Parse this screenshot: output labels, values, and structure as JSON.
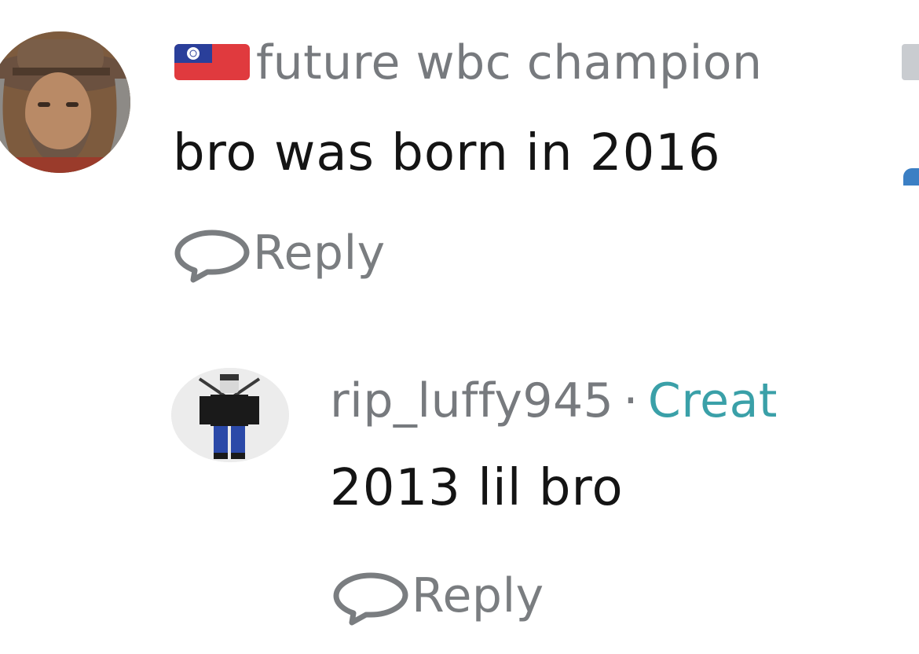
{
  "comment": {
    "username": "future wbc champion",
    "text": "bro was born in 2016",
    "reply_label": "Reply",
    "flag_icon": "taiwan-flag-icon"
  },
  "reply_comment": {
    "username": "rip_luffy945",
    "separator": "·",
    "badge": "Creat",
    "text": "2013 lil bro",
    "reply_label": "Reply"
  },
  "colors": {
    "muted_text": "#777a7e",
    "body_text": "#141414",
    "creator_badge": "#3aa0a8",
    "background": "#ffffff"
  }
}
